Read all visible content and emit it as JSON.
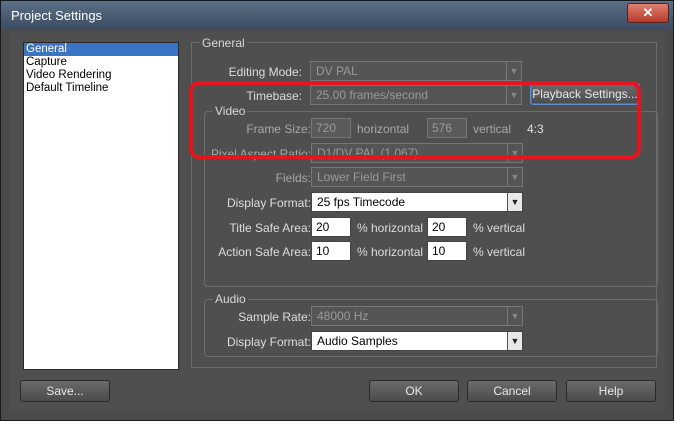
{
  "window": {
    "title": "Project Settings",
    "close_glyph": "✕"
  },
  "sidebar": {
    "items": [
      {
        "label": "General"
      },
      {
        "label": "Capture"
      },
      {
        "label": "Video Rendering"
      },
      {
        "label": "Default Timeline"
      }
    ],
    "selected_index": 0
  },
  "general": {
    "panel_title": "General",
    "editing_mode": {
      "label": "Editing Mode:",
      "value": "DV PAL"
    },
    "timebase": {
      "label": "Timebase:",
      "value": "25.00 frames/second"
    },
    "playback_settings_label": "Playback Settings...",
    "video": {
      "group_title": "Video",
      "frame_size": {
        "label": "Frame Size:",
        "width": "720",
        "height": "576",
        "horizontal_label": "horizontal",
        "vertical_label": "vertical",
        "aspect": "4:3"
      },
      "pixel_aspect_ratio": {
        "label": "Pixel Aspect Ratio:",
        "value": "D1/DV PAL (1.067)"
      },
      "fields": {
        "label": "Fields:",
        "value": "Lower Field First"
      },
      "display_format": {
        "label": "Display Format:",
        "value": "25 fps Timecode"
      },
      "title_safe": {
        "label": "Title Safe Area:",
        "horizontal": "20",
        "vertical": "20",
        "horizontal_label": "% horizontal",
        "vertical_label": "% vertical"
      },
      "action_safe": {
        "label": "Action Safe Area:",
        "horizontal": "10",
        "vertical": "10",
        "horizontal_label": "% horizontal",
        "vertical_label": "% vertical"
      }
    },
    "audio": {
      "group_title": "Audio",
      "sample_rate": {
        "label": "Sample Rate:",
        "value": "48000 Hz"
      },
      "display_format": {
        "label": "Display Format:",
        "value": "Audio Samples"
      }
    }
  },
  "buttons": {
    "save": "Save...",
    "ok": "OK",
    "cancel": "Cancel",
    "help": "Help"
  },
  "colors": {
    "highlight_annotation": "#e8141d",
    "selection": "#3a74c4"
  }
}
